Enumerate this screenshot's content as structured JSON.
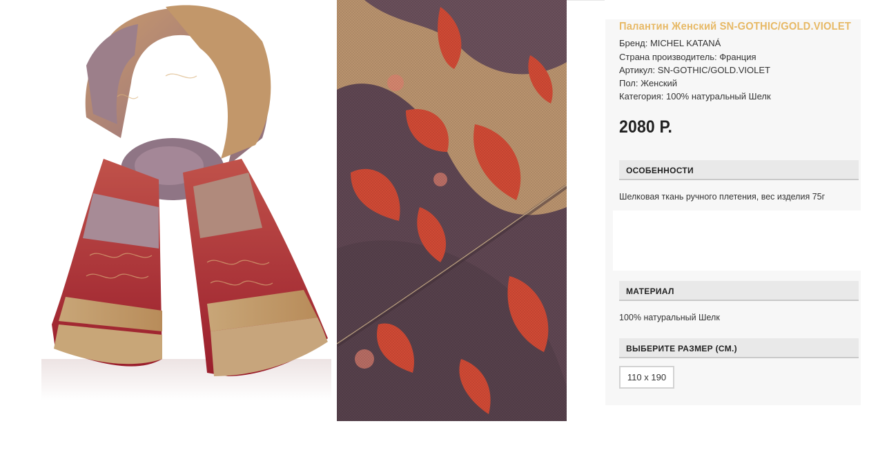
{
  "product": {
    "title": "Палантин Женский SN-GOTHIC/GOLD.VIOLET",
    "specs": [
      "Бренд: MICHEL KATANÁ",
      "Страна производитель: Франция",
      "Артикул: SN-GOTHIC/GOLD.VIOLET",
      "Пол: Женский",
      "Категория: 100% натуральный Шелк"
    ],
    "price": "2080 Р."
  },
  "sections": {
    "features": {
      "heading": "ОСОБЕННОСТИ",
      "text": "Шелковая ткань ручного плетения, вес изделия 75г"
    },
    "material": {
      "heading": "МАТЕРИАЛ",
      "text": "100% натуральный Шелк"
    },
    "size": {
      "heading": "ВЫБЕРИТЕ РАЗМЕР (СМ.)",
      "options": [
        "110 x 190"
      ]
    }
  },
  "colors": {
    "title": "#e7b966",
    "panel_bg": "#f7f7f7",
    "section_bg": "#e9e9e9"
  }
}
